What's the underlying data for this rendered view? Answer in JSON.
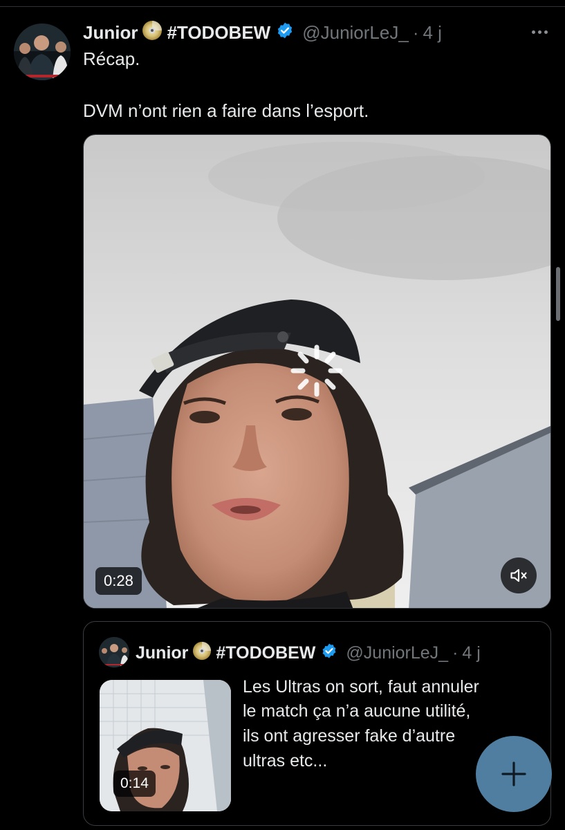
{
  "tweet": {
    "author_name": "Junior",
    "hashtag": "#TODOBEW",
    "handle": "@JuniorLeJ_",
    "separator": "·",
    "time": "4 j",
    "text_line1": "Récap.",
    "text_line2": "DVM n’ont rien a faire dans l’esport.",
    "video_duration": "0:28",
    "icons": {
      "more": "more-options-icon",
      "verified": "verified-badge-icon",
      "disc": "cd-disc-icon",
      "mute": "muted-speaker-icon",
      "loading": "loading-spinner-icon"
    }
  },
  "quoted_tweet": {
    "author_name": "Junior",
    "hashtag": "#TODOBEW",
    "handle": "@JuniorLeJ_",
    "separator": "·",
    "time": "4 j",
    "video_duration": "0:14",
    "text_lines": [
      "Les Ultras on sort, faut annuler",
      "le match ça n’a aucune utilité,",
      "ils ont agresser fake d’autre",
      "ultras etc..."
    ]
  },
  "compose_button": {
    "icon": "plus-icon"
  },
  "colors": {
    "background": "#000000",
    "text_primary": "#e7e9ea",
    "text_secondary": "#71767b",
    "verified_blue": "#1d9bf0",
    "fab": "#4f7ea0"
  }
}
